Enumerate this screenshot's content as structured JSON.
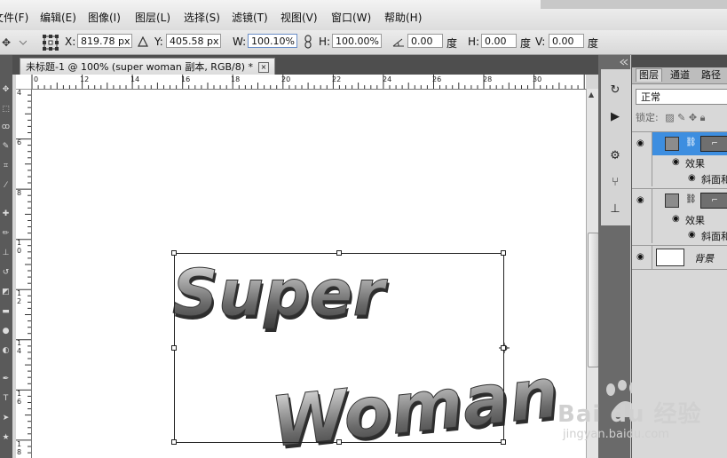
{
  "menubar": {
    "items": [
      "文件(F)",
      "编辑(E)",
      "图像(I)",
      "图层(L)",
      "选择(S)",
      "滤镜(T)",
      "视图(V)",
      "窗口(W)",
      "帮助(H)"
    ]
  },
  "options": {
    "x_label": "X:",
    "x_value": "819.78 px",
    "y_label": "Y:",
    "y_value": "405.58 px",
    "w_label": "W:",
    "w_value": "100.10%",
    "h_label": "H:",
    "h_value": "100.00%",
    "angle_value": "0.00",
    "angle_unit": "度",
    "hskew_label": "H:",
    "hskew_value": "0.00",
    "hskew_unit": "度",
    "vskew_label": "V:",
    "vskew_value": "0.00"
  },
  "document": {
    "tab_title": "未标题-1 @ 100% (super woman 副本, RGB/8) *",
    "close_glyph": "☒"
  },
  "ruler": {
    "h_labels": [
      "0",
      "12",
      "14",
      "16",
      "18",
      "20",
      "22",
      "24",
      "26",
      "28",
      "30"
    ],
    "v_labels": [
      "4",
      "6",
      "8",
      "1 0",
      "1 2",
      "1 4",
      "1 6",
      "1 8"
    ]
  },
  "canvas_text": {
    "line1": "Super",
    "line2": "Woman"
  },
  "layers_panel": {
    "tabs": [
      "图层",
      "通道",
      "路径"
    ],
    "blend_mode": "正常",
    "lock_label": "锁定:",
    "effect_label": "效果",
    "bevel_label": "斜面和",
    "background_label": "背景"
  },
  "watermark": {
    "brand": "Bai du 经验",
    "url": "jingyan.baidu.com"
  },
  "colors": {
    "selected_layer": "#3d8ee0",
    "dark_chrome": "#4e4e4e"
  }
}
